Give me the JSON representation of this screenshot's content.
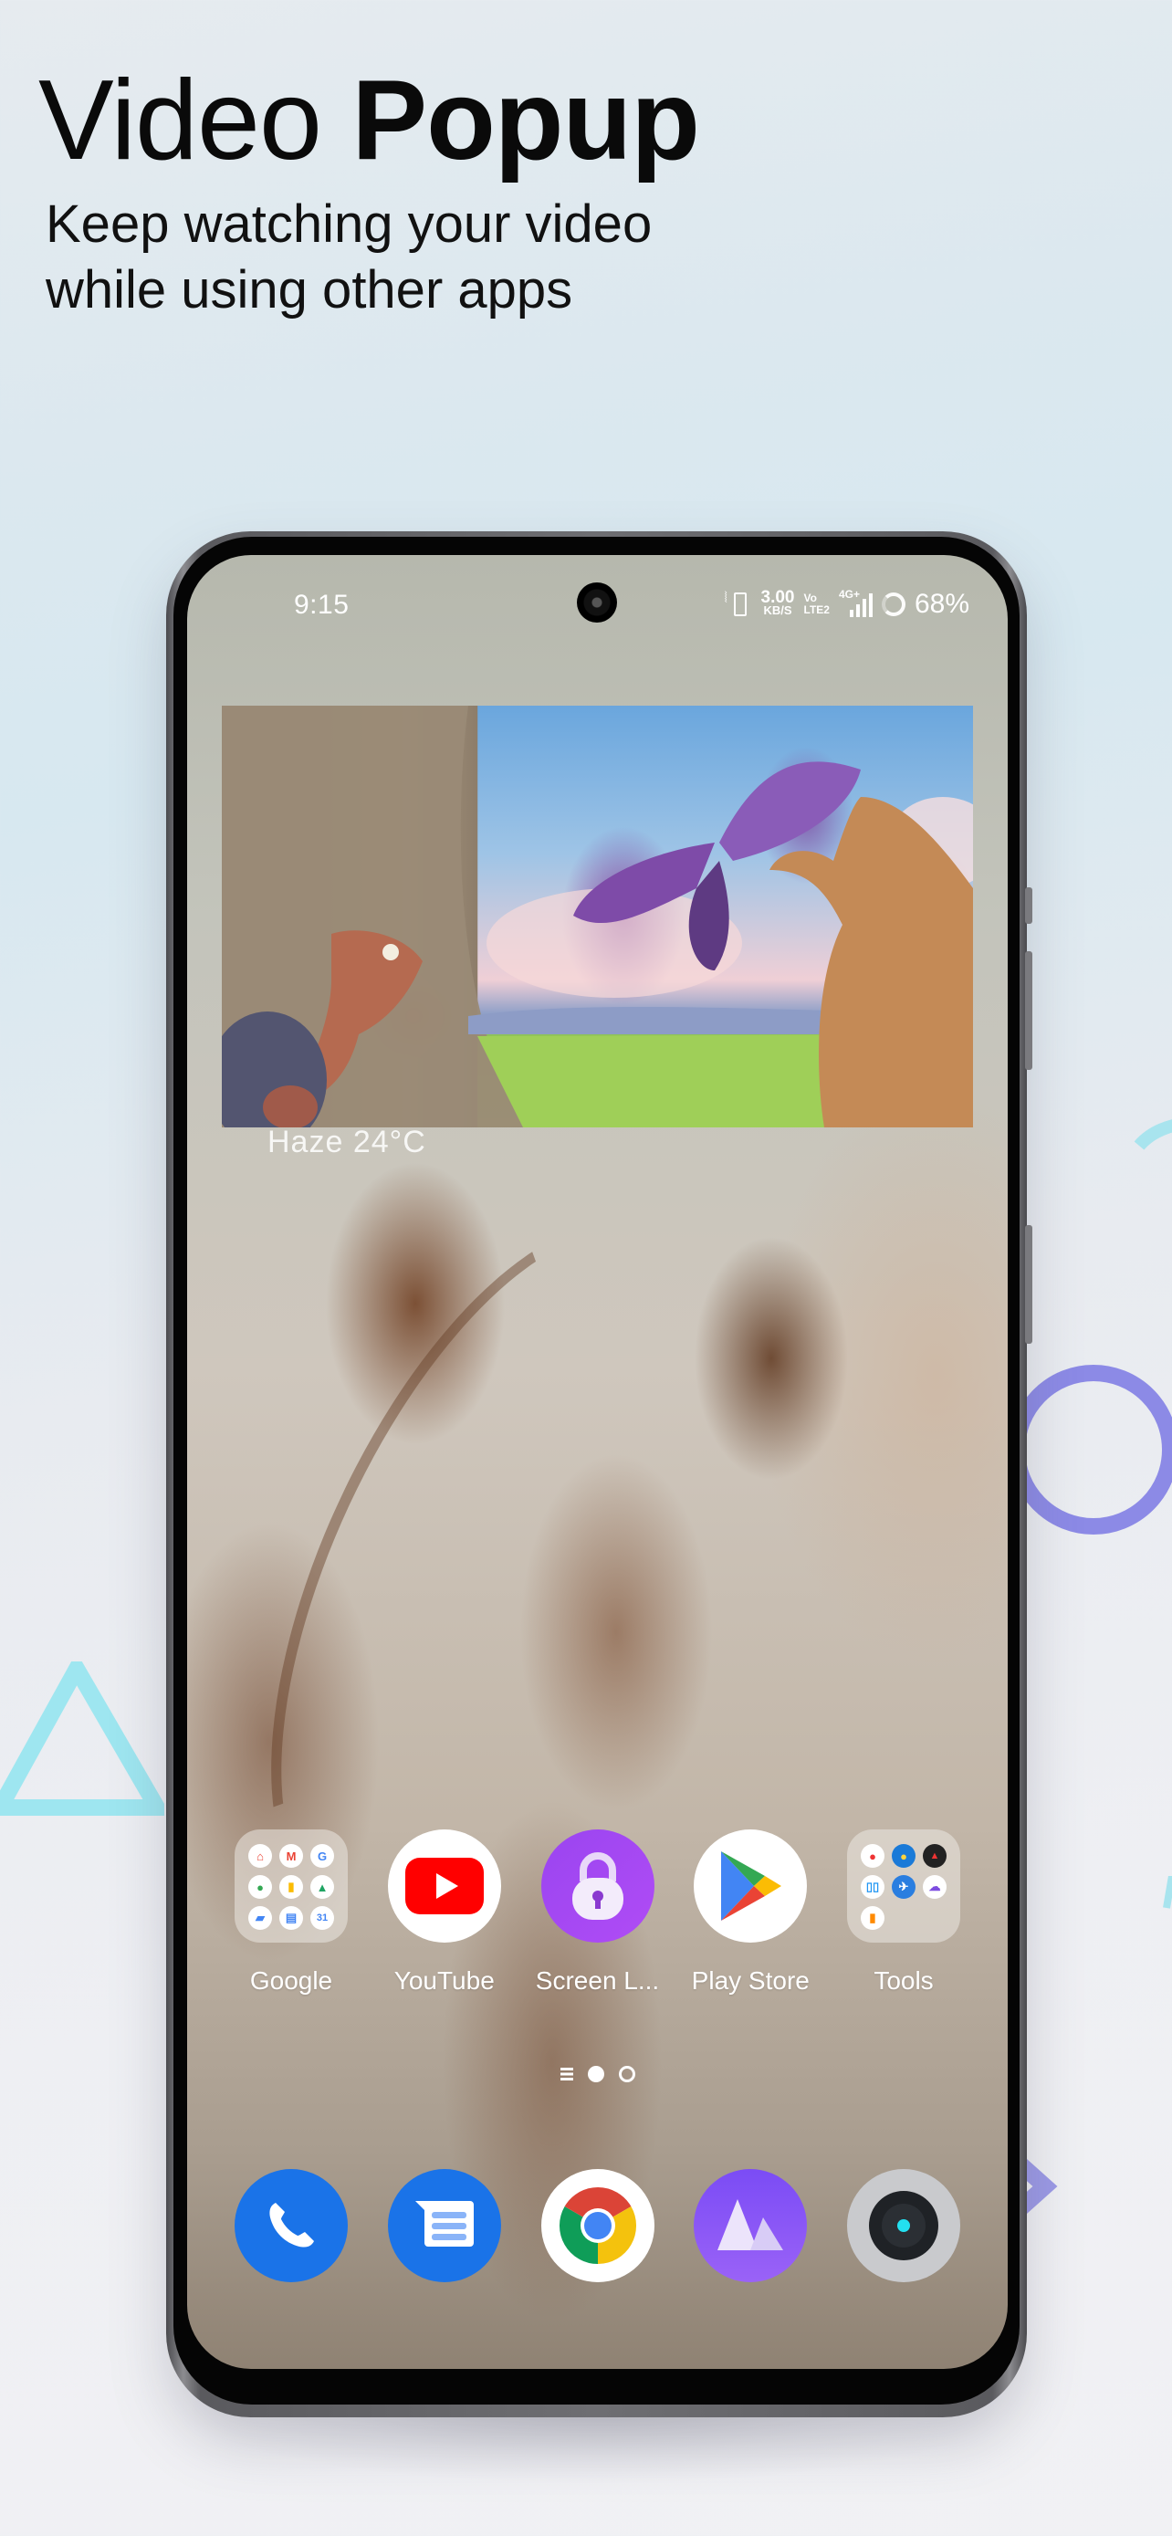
{
  "headline": {
    "title_regular": "Video",
    "title_bold": "Popup",
    "subtitle_line1": "Keep watching your video",
    "subtitle_line2": "while using other apps"
  },
  "colors": {
    "decor_cyan": "#9ee6f0",
    "decor_purple": "#8c8ae6",
    "youtube_red": "#ff0000",
    "screen_lock_purple": "#a44cf0",
    "phone_blue": "#1a73e8",
    "gallery_purple": "#8a5cf5"
  },
  "status_bar": {
    "time": "9:15",
    "net_speed_value": "3.00",
    "net_speed_unit": "KB/S",
    "volte_line1": "Vo",
    "volte_line2": "LTE2",
    "network_type": "4G+",
    "battery_percent": "68%",
    "icons": [
      "vibrate-icon",
      "volte-icon",
      "signal-icon",
      "battery-ring-icon"
    ]
  },
  "video_popup": {
    "description": "Animated movie scene: squirrel holding purple butterfly beside tree with rodent characters"
  },
  "weather_widget": {
    "text": "Haze  24°C"
  },
  "home_apps": [
    {
      "label": "Google",
      "type": "folder",
      "icon": "google-folder-icon"
    },
    {
      "label": "YouTube",
      "type": "app",
      "icon": "youtube-icon"
    },
    {
      "label": "Screen L...",
      "type": "app",
      "icon": "lock-icon"
    },
    {
      "label": "Play Store",
      "type": "app",
      "icon": "play-store-icon"
    },
    {
      "label": "Tools",
      "type": "folder",
      "icon": "tools-folder-icon"
    }
  ],
  "google_folder_apps": [
    "Home",
    "Gmail",
    "Google",
    "Maps",
    "Keep",
    "Drive",
    "Files",
    "Docs",
    "Calendar"
  ],
  "tools_folder_apps": [
    "Recorder",
    "Weather",
    "Compass",
    "Split screen",
    "Airplane",
    "Cloud",
    "Toggle"
  ],
  "page_indicator": {
    "pages": 2,
    "current": 1
  },
  "dock_apps": [
    {
      "name": "Phone",
      "icon": "phone-icon"
    },
    {
      "name": "Messages",
      "icon": "messages-icon"
    },
    {
      "name": "Chrome",
      "icon": "chrome-icon"
    },
    {
      "name": "Gallery",
      "icon": "gallery-icon"
    },
    {
      "name": "Camera",
      "icon": "camera-icon"
    }
  ]
}
